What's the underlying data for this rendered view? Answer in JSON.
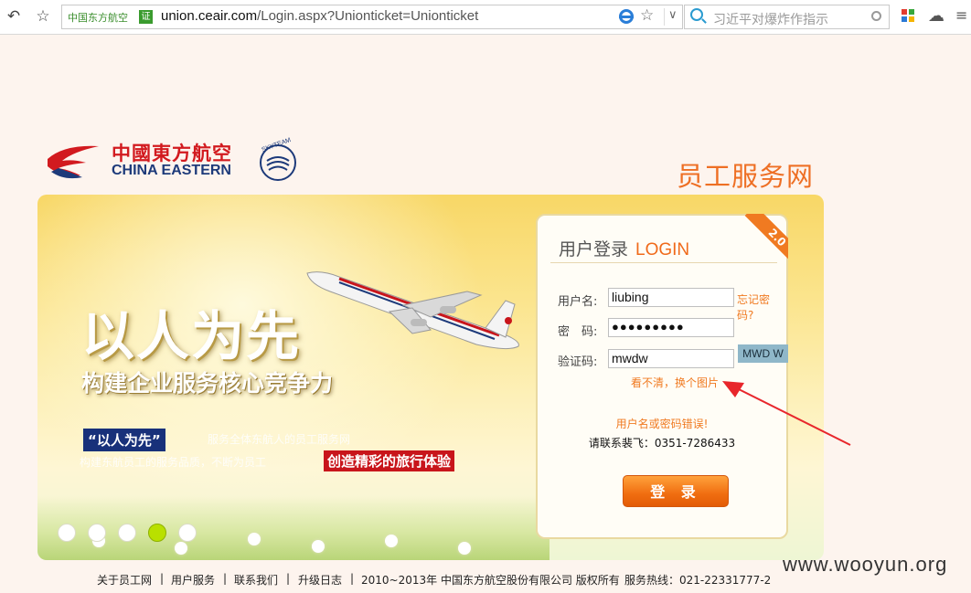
{
  "browser": {
    "site_tag": "中国东方航空",
    "cert_badge": "证",
    "url_host": "union.ceair.com",
    "url_path": "/Login.aspx?Unionticket=Unionticket",
    "search_placeholder": "习近平对爆炸作指示"
  },
  "header": {
    "logo_cn": "中國東方航空",
    "logo_en": "CHINA EASTERN",
    "portal_title": "员工服务网"
  },
  "banner": {
    "slogan": "以人为先",
    "sub_slogan": "构建企业服务核心竞争力",
    "tag1": "“以人为先”",
    "desc1": "服务全体东航人的员工服务网",
    "desc2": "构建东航员工的服务品质，不断为员工",
    "tag2": "创造精彩的旅行体验",
    "slide_count": 5,
    "active_slide": 4
  },
  "login": {
    "title": "用户登录",
    "title_en": "LOGIN",
    "ribbon": "2.0",
    "username_label": "用户名:",
    "username_value": "liubing",
    "forgot_link": "忘记密码?",
    "password_label": "密　码:",
    "password_value": "●●●●●●●●●",
    "captcha_label": "验证码:",
    "captcha_value": "mwdw",
    "captcha_image_text": "MWD W",
    "refresh_captcha": "看不清，换个图片",
    "error_message": "用户名或密码错误!",
    "contact": "请联系裴飞：0351-7286433",
    "submit": "登 录"
  },
  "footer": {
    "links": [
      "关于员工网",
      "用户服务",
      "联系我们",
      "升级日志"
    ],
    "copyright": "2010~2013年 中国东方航空股份有限公司 版权所有",
    "hotline": "服务热线：021-22331777-2"
  },
  "watermark": "www.wooyun.org",
  "colors": {
    "accent_orange": "#f07a21",
    "brand_red": "#d21a1f",
    "brand_blue": "#1d3a7a"
  }
}
